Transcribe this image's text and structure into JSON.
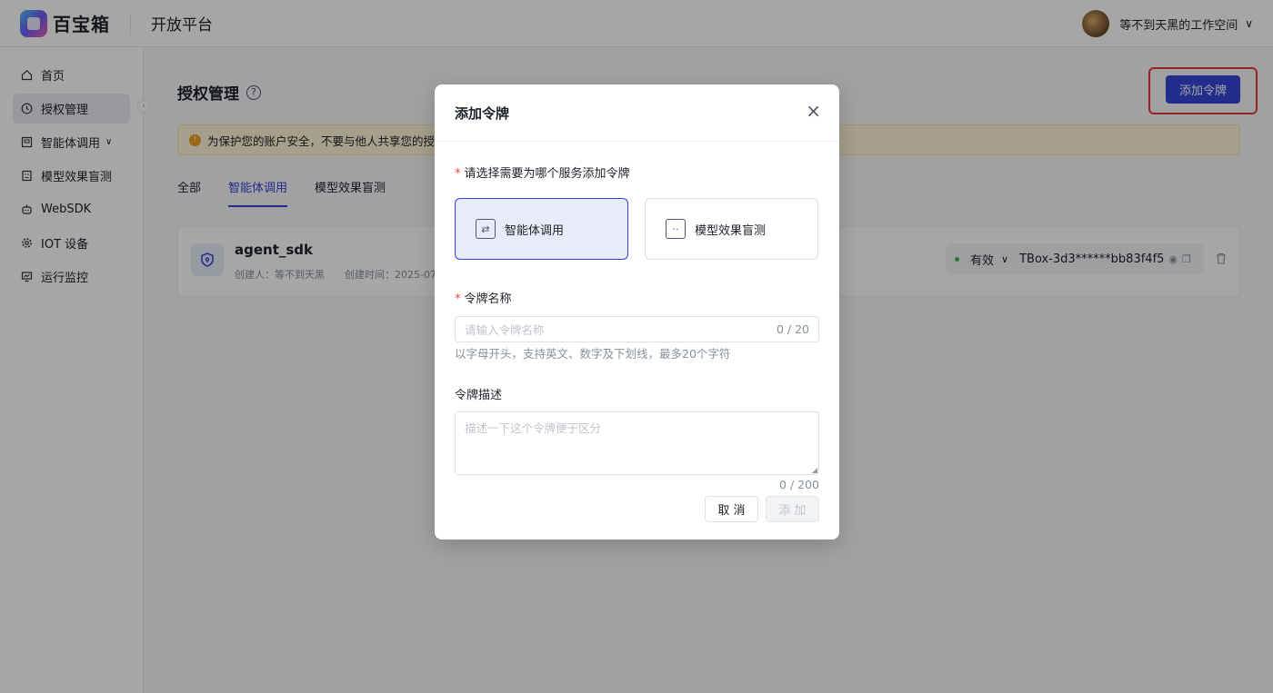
{
  "app": {
    "brand": "百宝箱",
    "platform": "开放平台"
  },
  "user": {
    "workspace": "等不到天黑的工作空间"
  },
  "sidebar": {
    "items": [
      {
        "label": "首页",
        "icon": "home-icon"
      },
      {
        "label": "授权管理",
        "icon": "clock-icon",
        "active": true
      },
      {
        "label": "智能体调用",
        "icon": "agent-icon",
        "expandable": true
      },
      {
        "label": "模型效果盲测",
        "icon": "blind-test-icon"
      },
      {
        "label": "WebSDK",
        "icon": "robot-icon"
      },
      {
        "label": "IOT 设备",
        "icon": "gear-icon"
      },
      {
        "label": "运行监控",
        "icon": "monitor-icon"
      }
    ]
  },
  "page": {
    "title": "授权管理",
    "add_button": "添加令牌",
    "notice": "为保护您的账户安全，不要与他人共享您的授",
    "tabs": [
      "全部",
      "智能体调用",
      "模型效果盲测"
    ],
    "active_tab": 1
  },
  "token_card": {
    "name": "agent_sdk",
    "creator": "创建人：等不到天黑",
    "created": "创建时间：2025-07",
    "status": "有效",
    "token": "TBox-3d3******bb83f4f5"
  },
  "modal": {
    "title": "添加令牌",
    "service_label": "请选择需要为哪个服务添加令牌",
    "services": [
      "智能体调用",
      "模型效果盲测"
    ],
    "selected_service": 0,
    "name_label": "令牌名称",
    "name_placeholder": "请输入令牌名称",
    "name_count": "0 / 20",
    "name_hint": "以字母开头，支持英文、数字及下划线，最多20个字符",
    "desc_label": "令牌描述",
    "desc_placeholder": "描述一下这个令牌便于区分",
    "desc_count": "0 / 200",
    "cancel": "取 消",
    "add": "添 加"
  },
  "colors": {
    "primary": "#3544d6",
    "highlight": "#e83a3a",
    "required": "#f53f3f",
    "notice_bg": "#fdf4d6"
  }
}
